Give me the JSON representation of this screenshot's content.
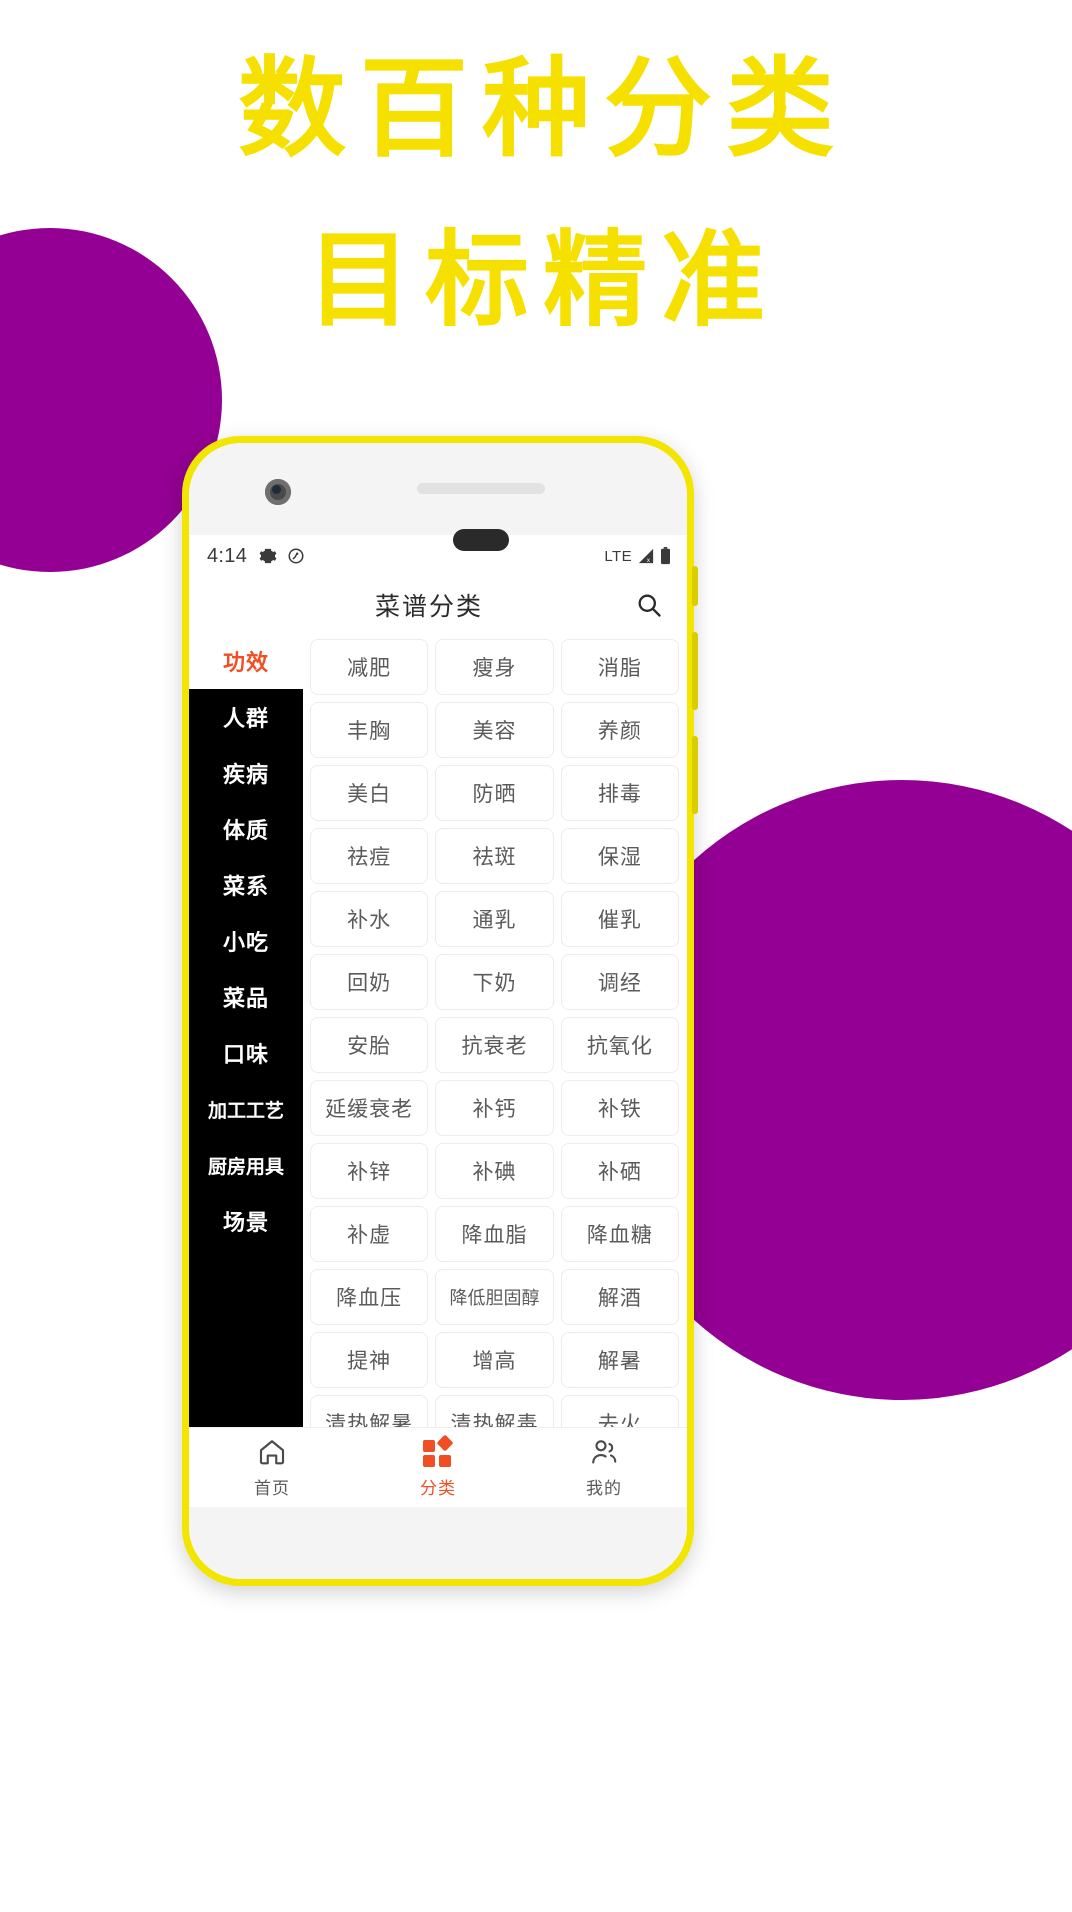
{
  "poster": {
    "headline_line1": "数百种分类",
    "headline_line2": "目标精准",
    "headline_color": "#F5E000",
    "accent_color": "#930093",
    "frame_color": "#F2E500"
  },
  "statusbar": {
    "time": "4:14",
    "settings_icon": "gear-icon",
    "dnd_icon": "do-not-disturb-icon",
    "network_label": "LTE",
    "signal_icon": "signal-bars-icon",
    "battery_icon": "battery-icon"
  },
  "appbar": {
    "title": "菜谱分类",
    "search_icon": "search-icon"
  },
  "sidebar": {
    "items": [
      {
        "label": "功效",
        "active": true
      },
      {
        "label": "人群",
        "active": false
      },
      {
        "label": "疾病",
        "active": false
      },
      {
        "label": "体质",
        "active": false
      },
      {
        "label": "菜系",
        "active": false
      },
      {
        "label": "小吃",
        "active": false
      },
      {
        "label": "菜品",
        "active": false
      },
      {
        "label": "口味",
        "active": false
      },
      {
        "label": "加工工艺",
        "active": false
      },
      {
        "label": "厨房用具",
        "active": false
      },
      {
        "label": "场景",
        "active": false
      }
    ]
  },
  "grid": {
    "chips": [
      "减肥",
      "瘦身",
      "消脂",
      "丰胸",
      "美容",
      "养颜",
      "美白",
      "防晒",
      "排毒",
      "祛痘",
      "祛斑",
      "保湿",
      "补水",
      "通乳",
      "催乳",
      "回奶",
      "下奶",
      "调经",
      "安胎",
      "抗衰老",
      "抗氧化",
      "延缓衰老",
      "补钙",
      "补铁",
      "补锌",
      "补碘",
      "补硒",
      "补虚",
      "降血脂",
      "降血糖",
      "降血压",
      "降低胆固醇",
      "解酒",
      "提神",
      "增高",
      "解暑",
      "清热解暑",
      "清热解毒",
      "去火"
    ]
  },
  "tabbar": {
    "tabs": [
      {
        "label": "首页",
        "icon": "home-icon",
        "active": false
      },
      {
        "label": "分类",
        "icon": "grid-icon",
        "active": true
      },
      {
        "label": "我的",
        "icon": "user-icon",
        "active": false
      }
    ]
  }
}
